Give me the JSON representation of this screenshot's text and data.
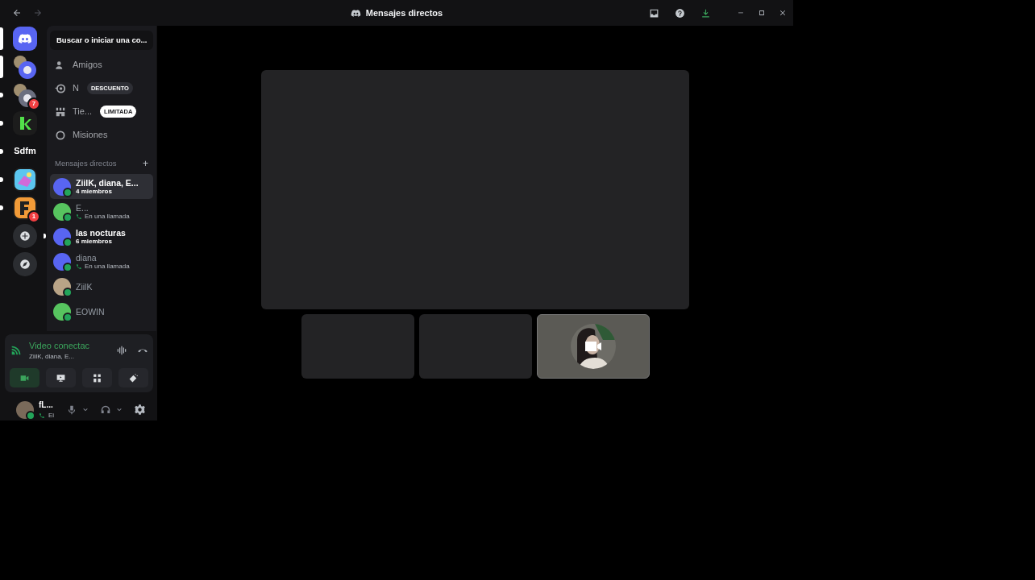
{
  "titlebar": {
    "title": "Mensajes directos"
  },
  "servers": [
    {
      "kind": "home",
      "selected": true,
      "unread": false
    },
    {
      "kind": "group",
      "selected": true,
      "unread": false
    },
    {
      "kind": "group",
      "selected": false,
      "unread": true,
      "badge": "7"
    },
    {
      "kind": "logo",
      "selected": false,
      "unread": true
    },
    {
      "kind": "text",
      "label": "Sdfm",
      "selected": false,
      "unread": true
    },
    {
      "kind": "logo",
      "selected": false,
      "unread": true
    },
    {
      "kind": "logo",
      "selected": false,
      "unread": true,
      "badge": "1"
    },
    {
      "kind": "add",
      "selected": false,
      "unread": false
    },
    {
      "kind": "discover",
      "selected": false,
      "unread": false
    }
  ],
  "search": {
    "label": "Buscar o iniciar una co..."
  },
  "nav": [
    {
      "kind": "friends",
      "label": "Amigos"
    },
    {
      "kind": "nitro",
      "label": "N",
      "badge": "DESCUENTO"
    },
    {
      "kind": "shop",
      "label": "Tie...",
      "badge": "LIMITADA"
    },
    {
      "kind": "quests",
      "label": "Misiones"
    }
  ],
  "dm_header": {
    "label": "Mensajes directos",
    "add": "+"
  },
  "dms": [
    {
      "name": "ZiilK, diana, E...",
      "subtitle": "4 miembros",
      "in_call": false,
      "selected": true,
      "unread": true,
      "color": "#5865f2"
    },
    {
      "name": "E...",
      "subtitle": "En una llamada",
      "in_call": true,
      "selected": false,
      "unread": false,
      "color": "#57c45f"
    },
    {
      "name": "las nocturas",
      "subtitle": "6 miembros",
      "in_call": false,
      "selected": false,
      "unread": true,
      "color": "#5865f2"
    },
    {
      "name": "diana",
      "subtitle": "En una llamada",
      "in_call": true,
      "selected": false,
      "unread": false,
      "color": "#5865f2"
    },
    {
      "name": "ZiilK",
      "selected": false,
      "unread": false,
      "color": "#b9a487"
    },
    {
      "name": "EOWIN",
      "selected": false,
      "unread": false,
      "color": "#57c45f"
    }
  ],
  "voice": {
    "status": "Video conectac",
    "members": "ZiilK, diana, E...",
    "buttons": [
      {
        "kind": "camera",
        "on": true
      },
      {
        "kind": "screen",
        "on": false
      },
      {
        "kind": "activities",
        "on": false
      },
      {
        "kind": "soundboard",
        "on": false
      }
    ]
  },
  "user": {
    "name": "fL...",
    "status": "Ei"
  },
  "video": {
    "tiles": [
      {
        "kind": "main"
      },
      {
        "kind": "blank"
      },
      {
        "kind": "blank"
      },
      {
        "kind": "camera_off"
      }
    ]
  }
}
